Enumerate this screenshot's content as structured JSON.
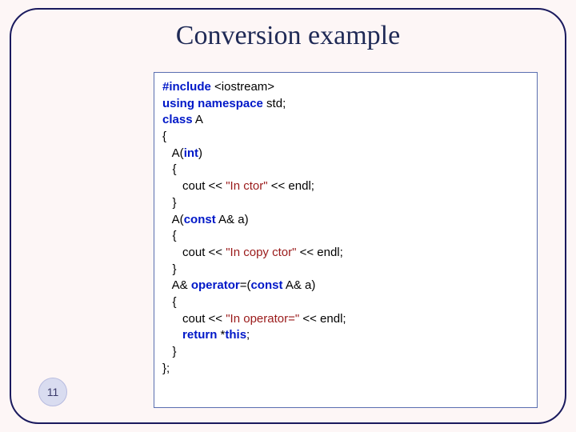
{
  "title": "Conversion example",
  "slide_number": "11",
  "code": {
    "l1a": "#include",
    "l1b": " <iostream>",
    "l2a": "using",
    "l2b": " ",
    "l2c": "namespace",
    "l2d": " std;",
    "l3a": "class",
    "l3b": " A",
    "l4": "{",
    "l5a": "   A(",
    "l5b": "int",
    "l5c": ")",
    "l6": "   {",
    "l7a": "      cout << ",
    "l7b": "\"In ctor\"",
    "l7c": " << endl;",
    "l8": "   }",
    "l9a": "   A(",
    "l9b": "const",
    "l9c": " A& a)",
    "l10": "   {",
    "l11a": "      cout << ",
    "l11b": "\"In copy ctor\"",
    "l11c": " << endl;",
    "l12": "   }",
    "l13a": "   A& ",
    "l13b": "operator",
    "l13c": "=(",
    "l13d": "const",
    "l13e": " A& a)",
    "l14": "   {",
    "l15a": "      cout << ",
    "l15b": "\"In operator=\"",
    "l15c": " << endl;",
    "l16a": "      ",
    "l16b": "return",
    "l16c": " *",
    "l16d": "this",
    "l16e": ";",
    "l17": "   }",
    "l18": "};"
  }
}
